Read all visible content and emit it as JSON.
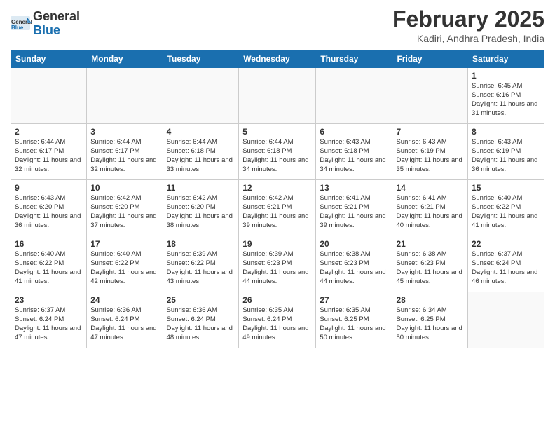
{
  "header": {
    "logo_line1": "General",
    "logo_line2": "Blue",
    "title": "February 2025",
    "subtitle": "Kadiri, Andhra Pradesh, India"
  },
  "days_of_week": [
    "Sunday",
    "Monday",
    "Tuesday",
    "Wednesday",
    "Thursday",
    "Friday",
    "Saturday"
  ],
  "weeks": [
    [
      {
        "day": "",
        "info": ""
      },
      {
        "day": "",
        "info": ""
      },
      {
        "day": "",
        "info": ""
      },
      {
        "day": "",
        "info": ""
      },
      {
        "day": "",
        "info": ""
      },
      {
        "day": "",
        "info": ""
      },
      {
        "day": "1",
        "info": "Sunrise: 6:45 AM\nSunset: 6:16 PM\nDaylight: 11 hours and 31 minutes."
      }
    ],
    [
      {
        "day": "2",
        "info": "Sunrise: 6:44 AM\nSunset: 6:17 PM\nDaylight: 11 hours and 32 minutes."
      },
      {
        "day": "3",
        "info": "Sunrise: 6:44 AM\nSunset: 6:17 PM\nDaylight: 11 hours and 32 minutes."
      },
      {
        "day": "4",
        "info": "Sunrise: 6:44 AM\nSunset: 6:18 PM\nDaylight: 11 hours and 33 minutes."
      },
      {
        "day": "5",
        "info": "Sunrise: 6:44 AM\nSunset: 6:18 PM\nDaylight: 11 hours and 34 minutes."
      },
      {
        "day": "6",
        "info": "Sunrise: 6:43 AM\nSunset: 6:18 PM\nDaylight: 11 hours and 34 minutes."
      },
      {
        "day": "7",
        "info": "Sunrise: 6:43 AM\nSunset: 6:19 PM\nDaylight: 11 hours and 35 minutes."
      },
      {
        "day": "8",
        "info": "Sunrise: 6:43 AM\nSunset: 6:19 PM\nDaylight: 11 hours and 36 minutes."
      }
    ],
    [
      {
        "day": "9",
        "info": "Sunrise: 6:43 AM\nSunset: 6:20 PM\nDaylight: 11 hours and 36 minutes."
      },
      {
        "day": "10",
        "info": "Sunrise: 6:42 AM\nSunset: 6:20 PM\nDaylight: 11 hours and 37 minutes."
      },
      {
        "day": "11",
        "info": "Sunrise: 6:42 AM\nSunset: 6:20 PM\nDaylight: 11 hours and 38 minutes."
      },
      {
        "day": "12",
        "info": "Sunrise: 6:42 AM\nSunset: 6:21 PM\nDaylight: 11 hours and 39 minutes."
      },
      {
        "day": "13",
        "info": "Sunrise: 6:41 AM\nSunset: 6:21 PM\nDaylight: 11 hours and 39 minutes."
      },
      {
        "day": "14",
        "info": "Sunrise: 6:41 AM\nSunset: 6:21 PM\nDaylight: 11 hours and 40 minutes."
      },
      {
        "day": "15",
        "info": "Sunrise: 6:40 AM\nSunset: 6:22 PM\nDaylight: 11 hours and 41 minutes."
      }
    ],
    [
      {
        "day": "16",
        "info": "Sunrise: 6:40 AM\nSunset: 6:22 PM\nDaylight: 11 hours and 41 minutes."
      },
      {
        "day": "17",
        "info": "Sunrise: 6:40 AM\nSunset: 6:22 PM\nDaylight: 11 hours and 42 minutes."
      },
      {
        "day": "18",
        "info": "Sunrise: 6:39 AM\nSunset: 6:22 PM\nDaylight: 11 hours and 43 minutes."
      },
      {
        "day": "19",
        "info": "Sunrise: 6:39 AM\nSunset: 6:23 PM\nDaylight: 11 hours and 44 minutes."
      },
      {
        "day": "20",
        "info": "Sunrise: 6:38 AM\nSunset: 6:23 PM\nDaylight: 11 hours and 44 minutes."
      },
      {
        "day": "21",
        "info": "Sunrise: 6:38 AM\nSunset: 6:23 PM\nDaylight: 11 hours and 45 minutes."
      },
      {
        "day": "22",
        "info": "Sunrise: 6:37 AM\nSunset: 6:24 PM\nDaylight: 11 hours and 46 minutes."
      }
    ],
    [
      {
        "day": "23",
        "info": "Sunrise: 6:37 AM\nSunset: 6:24 PM\nDaylight: 11 hours and 47 minutes."
      },
      {
        "day": "24",
        "info": "Sunrise: 6:36 AM\nSunset: 6:24 PM\nDaylight: 11 hours and 47 minutes."
      },
      {
        "day": "25",
        "info": "Sunrise: 6:36 AM\nSunset: 6:24 PM\nDaylight: 11 hours and 48 minutes."
      },
      {
        "day": "26",
        "info": "Sunrise: 6:35 AM\nSunset: 6:24 PM\nDaylight: 11 hours and 49 minutes."
      },
      {
        "day": "27",
        "info": "Sunrise: 6:35 AM\nSunset: 6:25 PM\nDaylight: 11 hours and 50 minutes."
      },
      {
        "day": "28",
        "info": "Sunrise: 6:34 AM\nSunset: 6:25 PM\nDaylight: 11 hours and 50 minutes."
      },
      {
        "day": "",
        "info": ""
      }
    ]
  ]
}
